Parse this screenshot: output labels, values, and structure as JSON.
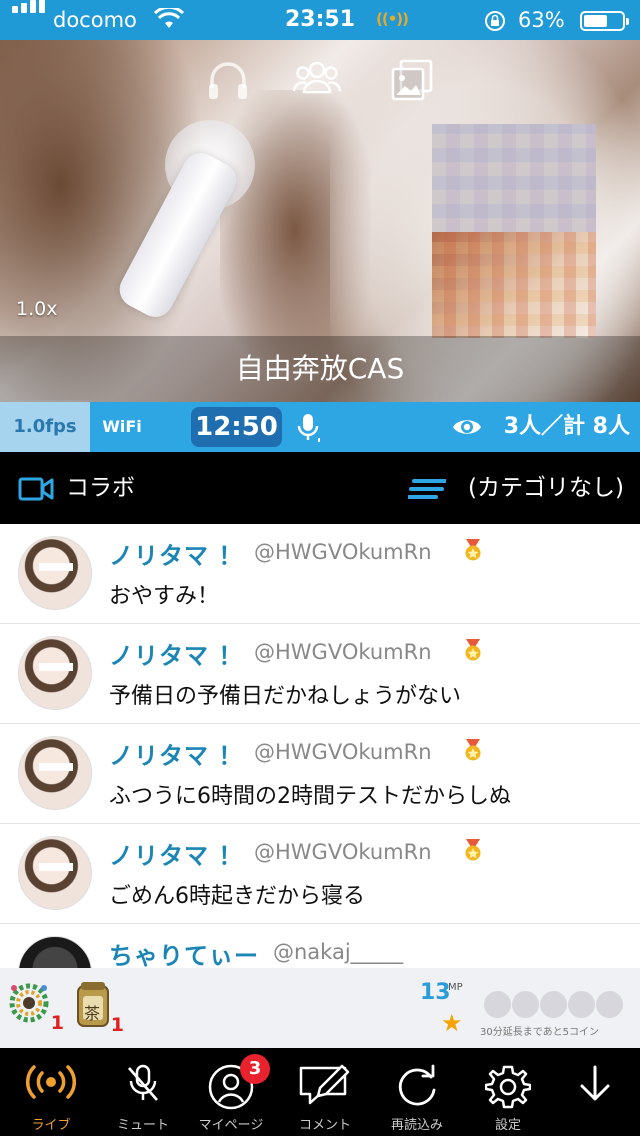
{
  "status_bar": {
    "carrier": "docomo",
    "time": "23:51",
    "battery_percent": "63%",
    "battery_level": 0.63
  },
  "video": {
    "zoom": "1.0x",
    "title": "自由奔放CAS"
  },
  "info_bar": {
    "fps": "1.0fps",
    "network": "WiFi",
    "timer": "12:50",
    "viewers": "3人／計 8人"
  },
  "collab_bar": {
    "collab_label": "コラボ",
    "category_label": "(カテゴリなし)"
  },
  "comments": [
    {
      "name": "ノリタマ ！",
      "handle": "@HWGVOkumRn",
      "text": "おやすみ！"
    },
    {
      "name": "ノリタマ ！",
      "handle": "@HWGVOkumRn",
      "text": "予備日の予備日だかねしょうがない"
    },
    {
      "name": "ノリタマ ！",
      "handle": "@HWGVOkumRn",
      "text": "ふつうに6時間の2時間テストだからしぬ"
    },
    {
      "name": "ノリタマ ！",
      "handle": "@HWGVOkumRn",
      "text": "ごめん6時起きだから寝る"
    },
    {
      "name": "ちゃりてぃー",
      "handle": "@nakaj_____",
      "text": ""
    }
  ],
  "gift_bar": {
    "gifts": [
      {
        "icon": "wreath-gift-icon",
        "count": "1"
      },
      {
        "icon": "tea-gift-icon",
        "count": "1",
        "label": "茶"
      }
    ],
    "mp_value": "13",
    "mp_label": "MP",
    "coins_total": 5,
    "coins_filled": 0,
    "coin_note": "30分延長まであと5コイン"
  },
  "tab_bar": {
    "items": [
      {
        "label": "ライブ",
        "icon": "live-broadcast-icon",
        "active": true
      },
      {
        "label": "ミュート",
        "icon": "mic-muted-icon"
      },
      {
        "label": "マイページ",
        "icon": "profile-icon",
        "badge": "3"
      },
      {
        "label": "コメント",
        "icon": "comment-edit-icon"
      },
      {
        "label": "再読込み",
        "icon": "reload-icon"
      },
      {
        "label": "設定",
        "icon": "gear-icon"
      },
      {
        "label": "",
        "icon": "arrow-down-icon"
      }
    ]
  },
  "colors": {
    "accent_blue": "#2fa6e4",
    "name_blue": "#1b86b6",
    "active_orange": "#f0a030",
    "badge_red": "#e8232d"
  }
}
